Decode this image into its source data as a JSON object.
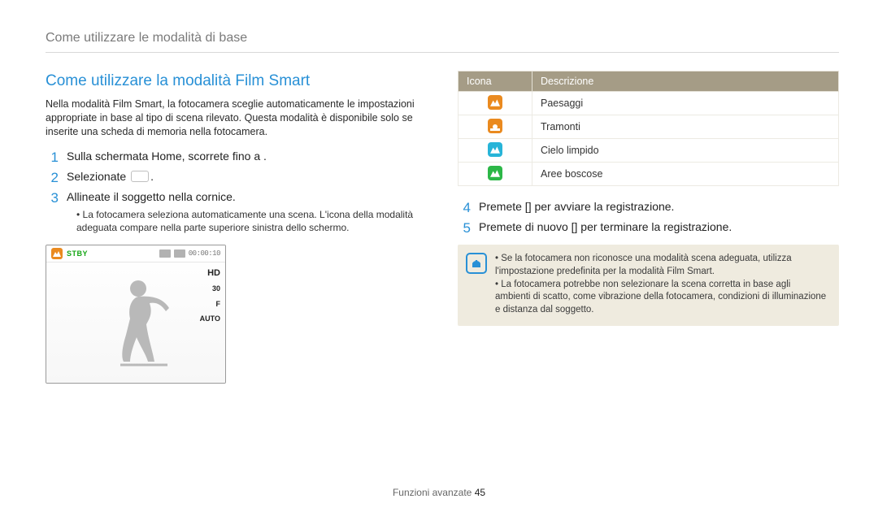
{
  "header": {
    "breadcrumb": "Come utilizzare le modalità di base"
  },
  "title": "Come utilizzare la modalità Film Smart",
  "intro": "Nella modalità Film Smart, la fotocamera sceglie automaticamente le impostazioni appropriate in base al tipo di scena rilevato. Questa modalità è disponibile solo se inserite una scheda di memoria nella fotocamera.",
  "steps_left": [
    {
      "num": "1",
      "text": "Sulla schermata Home, scorrete fino a ."
    },
    {
      "num": "2",
      "text": "Selezionate",
      "has_box": true,
      "suffix": "."
    },
    {
      "num": "3",
      "text": "Allineate il soggetto nella cornice.",
      "sub": [
        "La fotocamera seleziona automaticamente una scena. L'icona della modalità adeguata compare nella parte superiore sinistra dello schermo."
      ]
    }
  ],
  "camera": {
    "stby": "STBY",
    "timecode": "00:00:10",
    "hd": "HD",
    "fps": "30",
    "f_label": "F",
    "mode": "AUTO"
  },
  "icon_table": {
    "headers": {
      "icon": "Icona",
      "desc": "Descrizione"
    },
    "rows": [
      {
        "color": "orange",
        "glyph": "mount",
        "desc": "Paesaggi"
      },
      {
        "color": "orange",
        "glyph": "sunset",
        "desc": "Tramonti"
      },
      {
        "color": "cyan",
        "glyph": "mount",
        "desc": "Cielo limpido"
      },
      {
        "color": "green",
        "glyph": "mount",
        "desc": "Aree boscose"
      }
    ]
  },
  "steps_right": [
    {
      "num": "4",
      "text": "Premete [] per avviare la registrazione."
    },
    {
      "num": "5",
      "text": "Premete di nuovo [] per terminare la registrazione."
    }
  ],
  "note": [
    "Se la fotocamera non riconosce una modalità scena adeguata, utilizza l'impostazione predefinita per la modalità Film Smart.",
    "La fotocamera potrebbe non selezionare la scena corretta in base agli ambienti di scatto, come vibrazione della fotocamera, condizioni di illuminazione e distanza dal soggetto."
  ],
  "footer": {
    "section": "Funzioni avanzate",
    "page": "45"
  }
}
